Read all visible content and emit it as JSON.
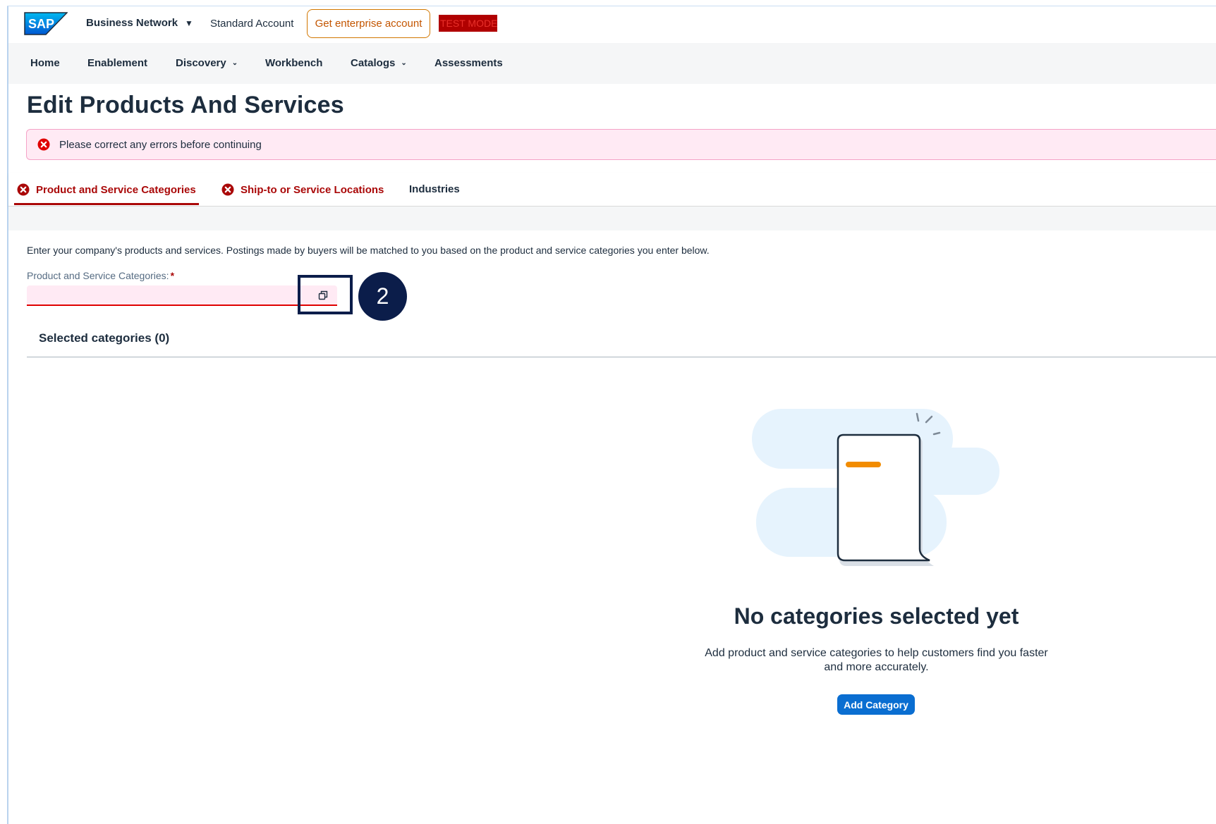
{
  "shell": {
    "logo_text": "SAP",
    "network_label": "Business Network",
    "account_type": "Standard Account",
    "enterprise_button": "Get enterprise account",
    "test_mode": "TEST MODE"
  },
  "nav": {
    "items": [
      {
        "label": "Home",
        "has_menu": false
      },
      {
        "label": "Enablement",
        "has_menu": false
      },
      {
        "label": "Discovery",
        "has_menu": true
      },
      {
        "label": "Workbench",
        "has_menu": false
      },
      {
        "label": "Catalogs",
        "has_menu": true
      },
      {
        "label": "Assessments",
        "has_menu": false
      }
    ]
  },
  "page": {
    "title": "Edit Products And Services",
    "error_message": "Please correct any errors before continuing"
  },
  "tabs": [
    {
      "label": "Product and Service Categories",
      "error": true,
      "selected": true
    },
    {
      "label": "Ship-to or Service Locations",
      "error": true,
      "selected": false
    },
    {
      "label": "Industries",
      "error": false,
      "selected": false
    }
  ],
  "form": {
    "intro": "Enter your company's products and services. Postings made by buyers will be matched to you based on the product and service categories you enter below.",
    "field_label": "Product and Service Categories:",
    "required_mark": "*",
    "field_value": "",
    "selected_header": "Selected categories (0)"
  },
  "empty_state": {
    "title": "No categories selected yet",
    "description": "Add product and service categories to help customers find you faster and more accurately.",
    "add_button": "Add Category"
  },
  "annotation": {
    "step_number": "2"
  },
  "colors": {
    "error_red": "#aa0808",
    "primary_blue": "#0a6ed1",
    "annotation_navy": "#0b1d4a",
    "enterprise_orange": "#c35500"
  },
  "icons": {
    "value_help": "value-help-icon",
    "error": "error-circle-icon"
  }
}
